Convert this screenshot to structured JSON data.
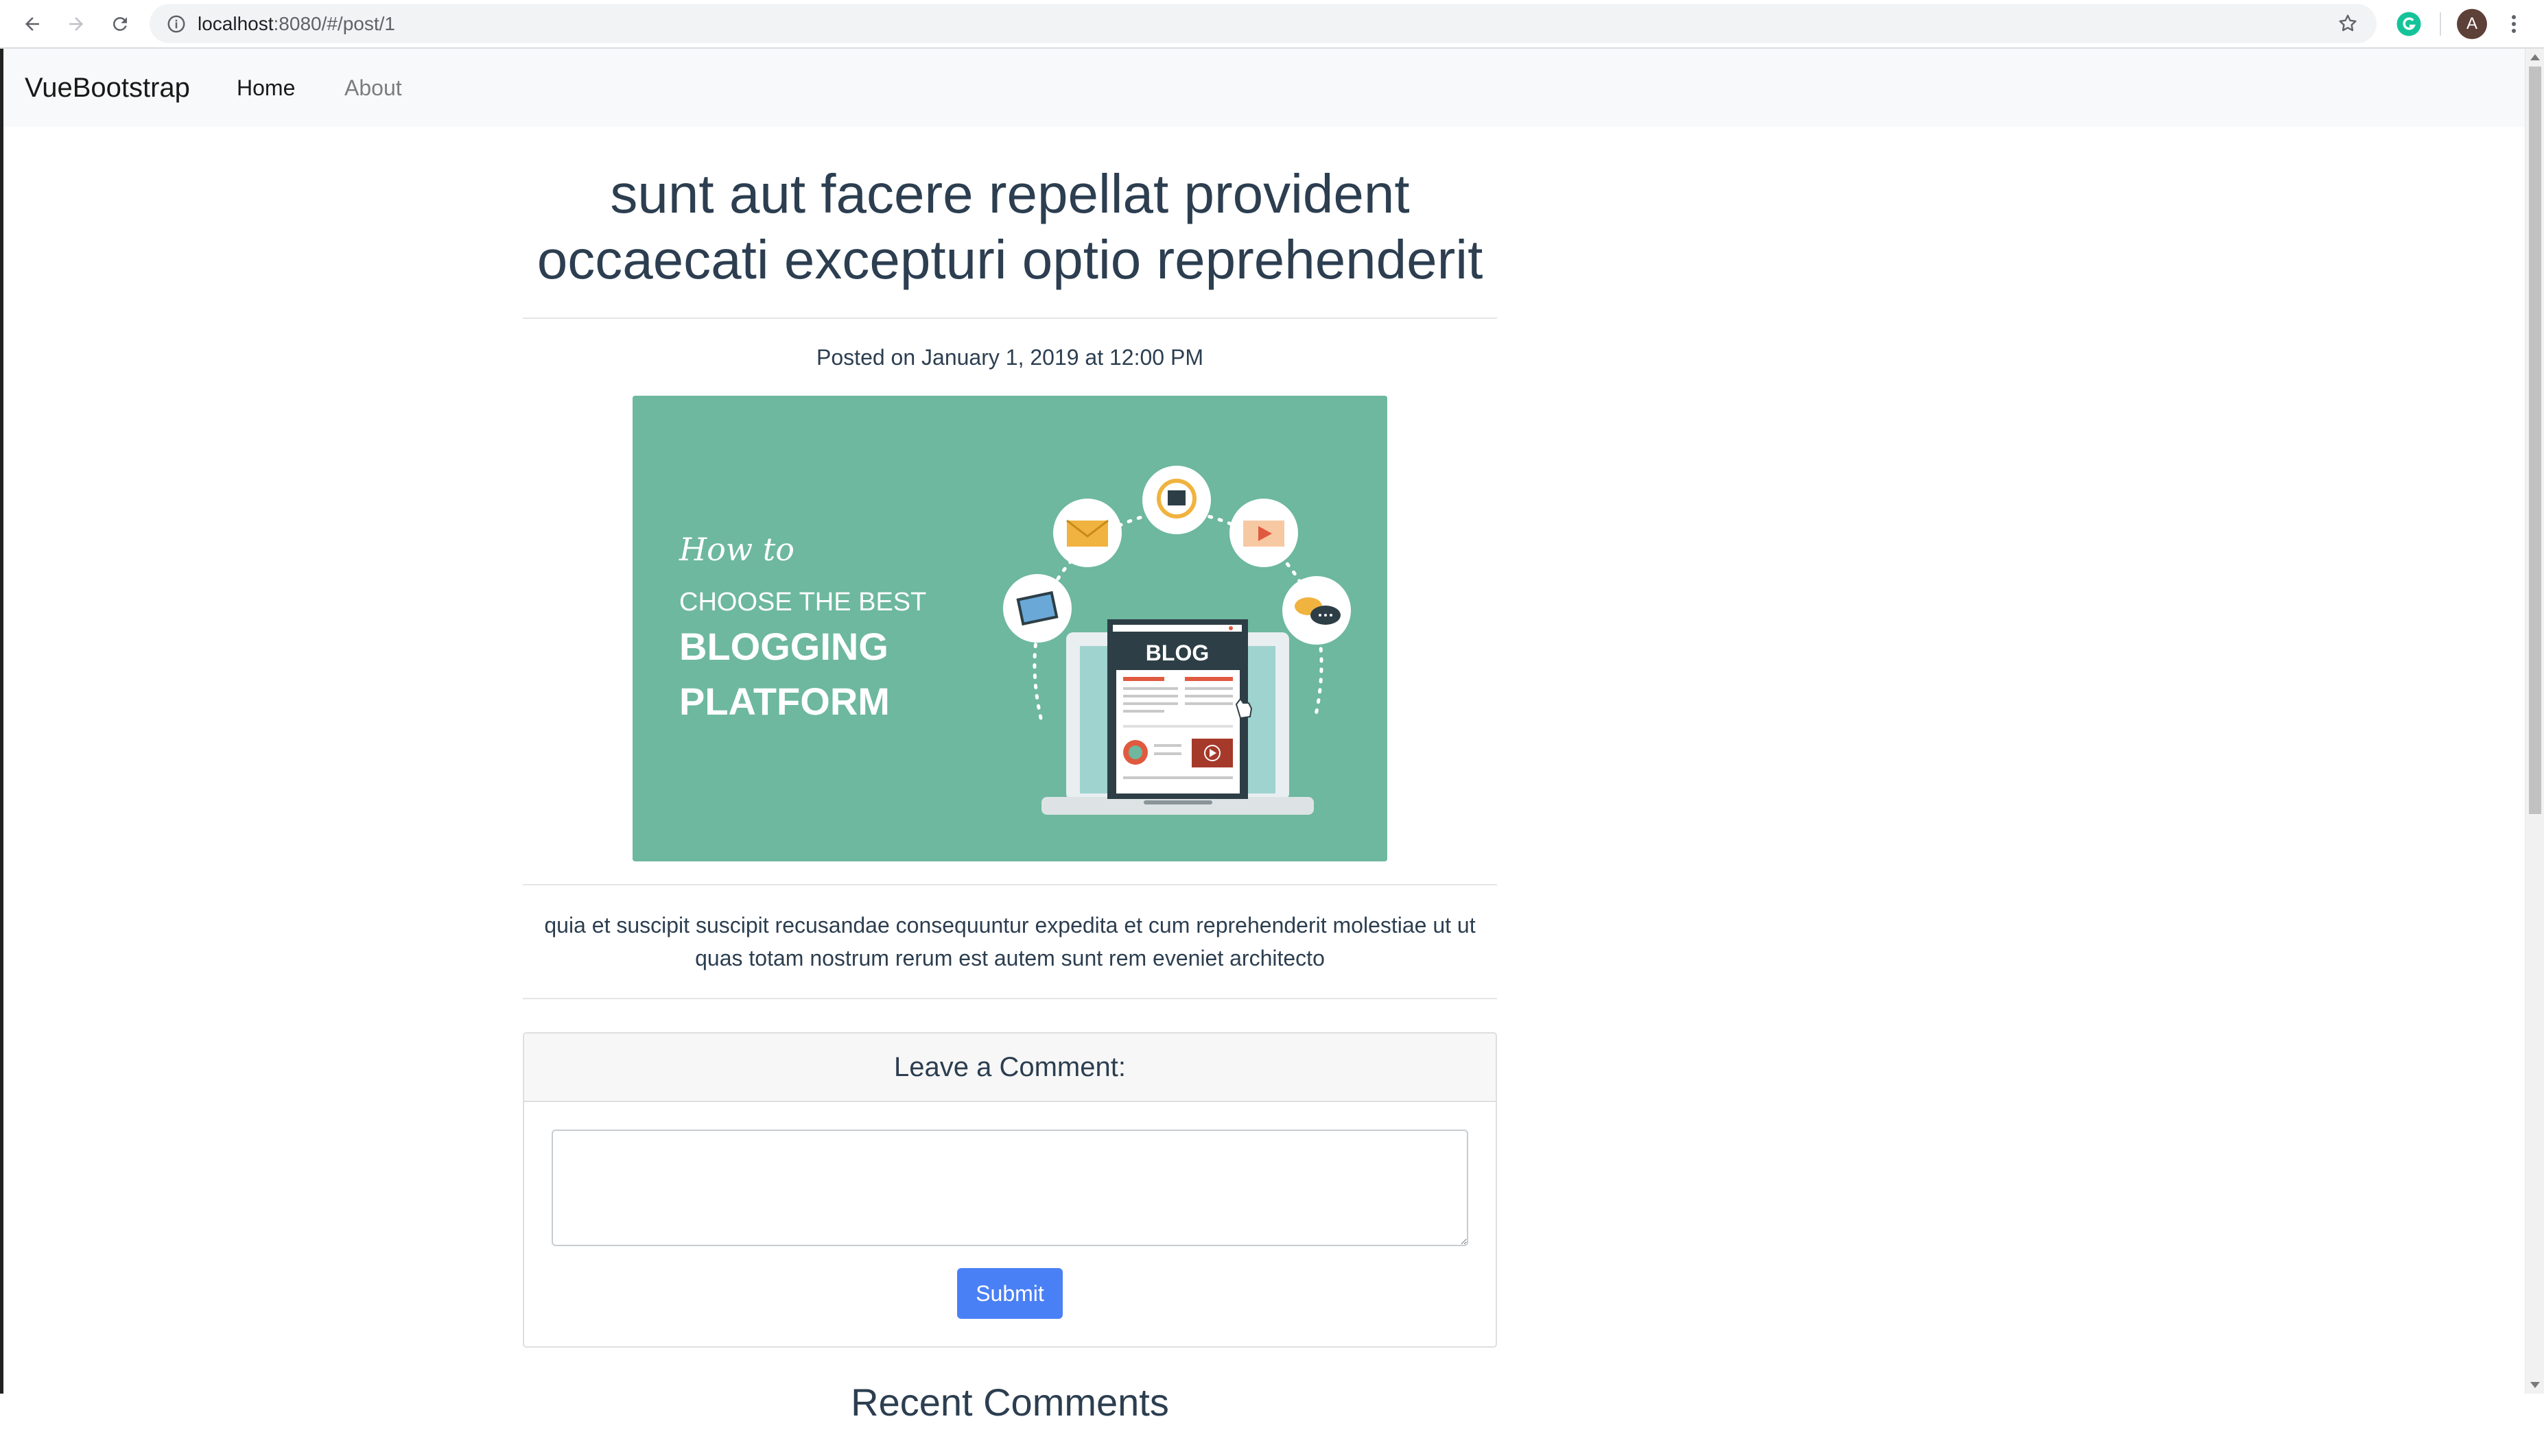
{
  "browser": {
    "url_host": "localhost",
    "url_rest": ":8080/#/post/1",
    "profile_initial": "A"
  },
  "navbar": {
    "brand": "VueBootstrap",
    "items": [
      {
        "label": "Home",
        "active": true
      },
      {
        "label": "About",
        "active": false
      }
    ]
  },
  "post": {
    "title": "sunt aut facere repellat provident occaecati excepturi optio reprehenderit",
    "posted": "Posted on January 1, 2019 at 12:00 PM",
    "image": {
      "line1": "How to",
      "line2": "CHOOSE THE BEST",
      "line3": "BLOGGING",
      "line4": "PLATFORM",
      "screen_label": "BLOG"
    },
    "body": "quia et suscipit suscipit recusandae consequuntur expedita et cum reprehenderit molestiae ut ut quas totam nostrum rerum est autem sunt rem eveniet architecto"
  },
  "comment_form": {
    "heading": "Leave a Comment:",
    "textarea_value": "",
    "submit_label": "Submit"
  },
  "recent_comments": {
    "heading": "Recent Comments"
  },
  "colors": {
    "image_bg": "#6db89e",
    "primary_button": "#4a80f5",
    "text": "#2c3e50"
  }
}
